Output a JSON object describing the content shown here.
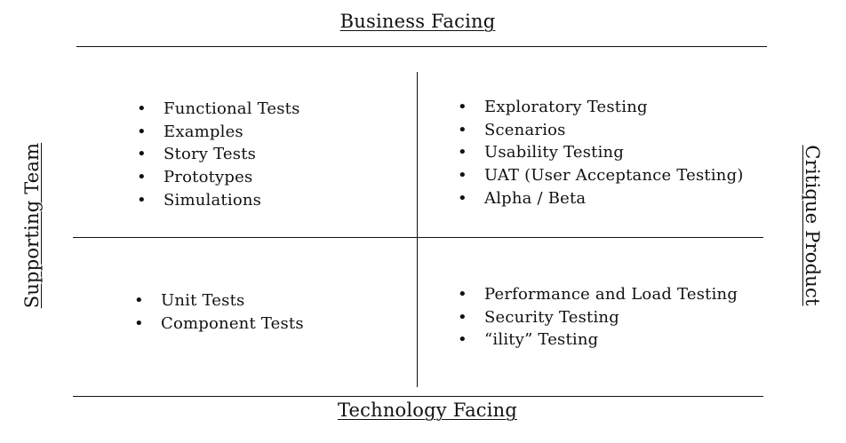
{
  "axes": {
    "top": "Business Facing",
    "bottom": "Technology Facing",
    "left": "Supporting Team",
    "right": "Critique Product"
  },
  "quadrants": {
    "top_left": [
      "Functional Tests",
      "Examples",
      "Story Tests",
      "Prototypes",
      "Simulations"
    ],
    "top_right": [
      "Exploratory Testing",
      "Scenarios",
      "Usability Testing",
      "UAT (User Acceptance Testing)",
      "Alpha / Beta"
    ],
    "bottom_left": [
      "Unit Tests",
      "Component Tests"
    ],
    "bottom_right": [
      "Performance and Load Testing",
      "Security Testing",
      "“ility” Testing"
    ]
  }
}
